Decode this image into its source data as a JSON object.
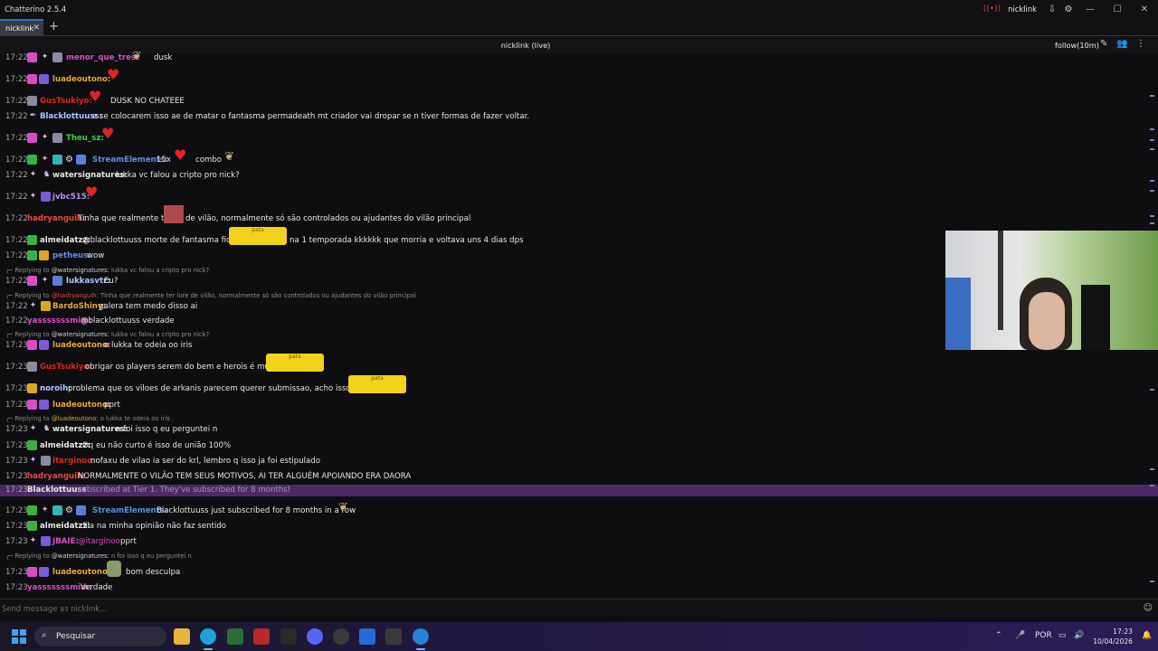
{
  "window": {
    "title": "Chatterino 2.5.4",
    "account": "nicklink"
  },
  "tabs": [
    {
      "label": "nicklink"
    }
  ],
  "channel": {
    "title": "nicklink (live)",
    "follow_mode": "follow(10m)"
  },
  "colors": {
    "sub_banner": "#4b2a6a",
    "accent": "#2f6fd6",
    "taskbar": "#241a44"
  },
  "messages": [
    {
      "time": "17:22",
      "user": "menor_que_tres:",
      "color": "#d94dc4",
      "text": "dusk"
    },
    {
      "time": "17:22",
      "user": "luadeoutono:",
      "color": "#e5a53a",
      "text": ""
    },
    {
      "time": "17:22",
      "user": "GusTsukiyo:",
      "color": "#e02424",
      "text": "DUSK NO CHATEEE"
    },
    {
      "time": "17:22",
      "user": "Blacklottuuss:",
      "color": "#a8c8ff",
      "text": "e se colocarem isso ae de matar o fantasma permadeath mt criador vai dropar se n tiver formas de fazer voltar."
    },
    {
      "time": "17:22",
      "user": "Theu_sz:",
      "color": "#3cd33c",
      "text": ""
    },
    {
      "time": "17:22",
      "user": "StreamElements:",
      "color": "#5b8fe0",
      "text": "15x",
      "text2": "combo"
    },
    {
      "time": "17:22",
      "user": "watersignatures:",
      "color": "#e6e6e6",
      "text": "lukka vc falou a cripto pro nick?"
    },
    {
      "time": "17:22",
      "user": "jvbc515:",
      "color": "#b98cf0",
      "text": ""
    },
    {
      "time": "17:22",
      "user": "hadryanguih:",
      "color": "#e84a4a",
      "text": "Tinha que realmente ter",
      "text2": "de vilão, normalmente só são controlados ou ajudantes do vilão principal"
    },
    {
      "time": "17:22",
      "user": "almeidatzz:",
      "color": "#e6e6e6",
      "text": "@blacklottuuss morte de fantasma ficou",
      "text2": "na 1 temporada kkkkkk que morria e voltava uns 4 dias dps"
    },
    {
      "time": "17:22",
      "user": "petheus:",
      "color": "#5b8fe0",
      "text": "wow"
    },
    {
      "time": "17:22",
      "user": "lukkasvtr:",
      "color": "#a8c8ff",
      "text": "Eu?"
    },
    {
      "time": "17:22",
      "user": "BardoShiny:",
      "color": "#e5a53a",
      "text": "galera tem medo disso ai"
    },
    {
      "time": "17:22",
      "user": "yasssssssmim:",
      "color": "#d94dc4",
      "text": "@blacklottuuss verdade"
    },
    {
      "time": "17:23",
      "user": "luadeoutono:",
      "color": "#e5a53a",
      "text": "o lukka te odeia oo iris"
    },
    {
      "time": "17:23",
      "user": "GusTsukiyo:",
      "color": "#e02424",
      "text": "obrigar os players serem do bem e herois é muito"
    },
    {
      "time": "17:23",
      "user": "noroih:",
      "color": "#a8c8ff",
      "text": "problema que os viloes de arkanis parecem querer submissao, acho isso meio"
    },
    {
      "time": "17:23",
      "user": "luadeoutono:",
      "color": "#e5a53a",
      "text": "pprt"
    },
    {
      "time": "17:23",
      "user": "watersignatures:",
      "color": "#e6e6e6",
      "text": "n foi isso q eu perguntei n"
    },
    {
      "time": "17:23",
      "user": "almeidatzz:",
      "color": "#e6e6e6",
      "text": "Oq eu não curto é isso de união 100%"
    },
    {
      "time": "17:23",
      "user": "itarginoo:",
      "color": "#e02424",
      "text": "nofaxu de vilao ia ser do krl, lembro q isso ja foi estipulado"
    },
    {
      "time": "17:23",
      "user": "hadryanguih:",
      "color": "#e84a4a",
      "text": "NORMALMENTE O VILÃO TEM SEUS MOTIVOS, AI TER ALGUÉM APOIANDO ERA DAORA"
    },
    {
      "time": "17:23",
      "user": "StreamElements:",
      "color": "#5b8fe0",
      "text": "Blacklottuuss just subscribed for 8 months in a row"
    },
    {
      "time": "17:23",
      "user": "almeidatzz:",
      "color": "#e6e6e6",
      "text": "Sla na minha opinião não faz sentido"
    },
    {
      "time": "17:23",
      "user": "JBAIE:",
      "color": "#d94dc4",
      "text": "@itarginoo",
      "text2": "pprt"
    },
    {
      "time": "17:23",
      "user": "luadeoutono:",
      "color": "#e5a53a",
      "text": "bom desculpa"
    },
    {
      "time": "17:23",
      "user": "yasssssssmim:",
      "color": "#d94dc4",
      "text": "Verdade"
    }
  ],
  "replies": [
    {
      "prefix": "Replying to",
      "user": "@watersignatures:",
      "user_color": "#cfcfcf",
      "text": "lukka vc falou a cripto pro nick?"
    },
    {
      "prefix": "Replying to",
      "user": "@hadryanguih:",
      "user_color": "#e84a4a",
      "text": "Tinha que realmente ter lore de vilão, normalmente só são controlados ou ajudantes do vilão principal"
    },
    {
      "prefix": "Replying to",
      "user": "@watersignatures:",
      "user_color": "#cfcfcf",
      "text": "lukka vc falou a cripto pro nick?"
    },
    {
      "prefix": "Replying to",
      "user": "@luadeoutono:",
      "user_color": "#e5a53a",
      "text": "o lukka te odeia oo iris"
    },
    {
      "prefix": "Replying to",
      "user": "@watersignatures:",
      "user_color": "#cfcfcf",
      "text": "n foi isso q eu perguntei n"
    }
  ],
  "subscription": {
    "time": "17:23",
    "user": "Blacklottuuss",
    "text": "subscribed at Tier 1. They've subscribed for 8 months!"
  },
  "emotes": {
    "pata_label": "pata"
  },
  "input": {
    "placeholder": "Send message as nicklink..."
  },
  "taskbar": {
    "search_label": "Pesquisar",
    "language": "POR",
    "time": "17:23",
    "date": "10/04/2026"
  }
}
